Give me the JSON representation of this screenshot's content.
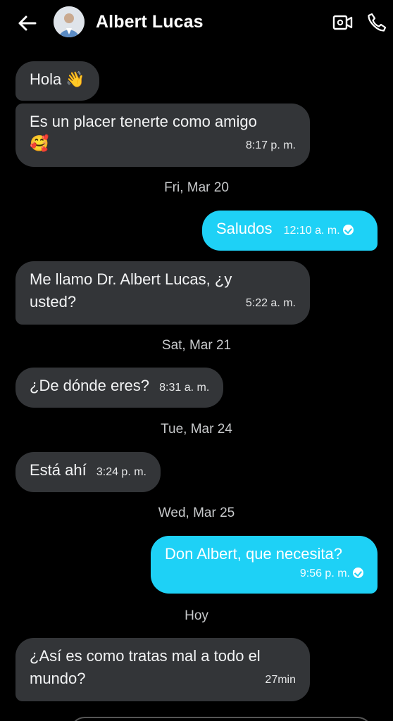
{
  "header": {
    "contact_name": "Albert Lucas"
  },
  "icons": {
    "back": "arrow-left-icon",
    "video": "video-camera-icon",
    "phone": "phone-icon"
  },
  "colors": {
    "outgoing_bubble": "#1ed1f6",
    "incoming_bubble": "#333538",
    "background": "#000000"
  },
  "messages": [
    {
      "dir": "in",
      "text": "Hola 👋"
    },
    {
      "dir": "in",
      "text_line1": "Es un placer tenerte como amigo",
      "text_line2": "🥰",
      "time": "8:17 p. m."
    },
    {
      "dir": "out",
      "text": "Saludos",
      "time": "12:10 a. m."
    },
    {
      "dir": "in",
      "text_line1": "Me llamo Dr. Albert Lucas, ¿y",
      "text_line2": "usted?",
      "time": "5:22 a. m."
    },
    {
      "dir": "in",
      "text": "¿De dónde eres?",
      "time": "8:31 a. m."
    },
    {
      "dir": "in",
      "text": "Está ahí",
      "time": "3:24 p. m."
    },
    {
      "dir": "out",
      "text": "Don Albert, que necesita?",
      "time": "9:56 p. m."
    },
    {
      "dir": "in",
      "text_line1": "¿Así es como tratas mal a todo el",
      "text_line2": "mundo?",
      "time": "27min"
    }
  ],
  "dates": [
    "Fri, Mar 20",
    "Sat, Mar 21",
    "Tue, Mar 24",
    "Wed, Mar 25",
    "Hoy"
  ]
}
